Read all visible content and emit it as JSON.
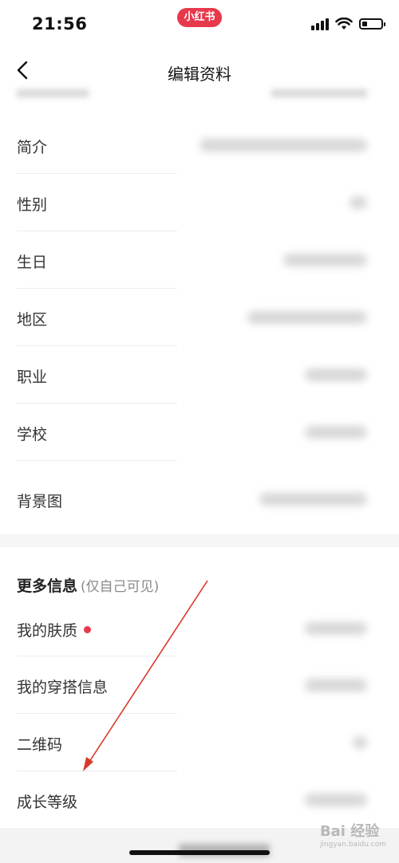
{
  "status_bar": {
    "time": "21:56",
    "app_badge": "小红书"
  },
  "nav": {
    "title": "编辑资料"
  },
  "rows": [
    {
      "label": "简介"
    },
    {
      "label": "性别"
    },
    {
      "label": "生日"
    },
    {
      "label": "地区"
    },
    {
      "label": "职业"
    },
    {
      "label": "学校"
    },
    {
      "label": "背景图"
    }
  ],
  "more_info": {
    "title": "更多信息",
    "note": "(仅自己可见)",
    "items": [
      {
        "label": "我的肤质",
        "has_dot": true
      },
      {
        "label": "我的穿搭信息"
      },
      {
        "label": "二维码"
      },
      {
        "label": "成长等级"
      }
    ]
  },
  "watermark": {
    "text": "Bai 经验",
    "sub": "jingyan.baidu.com"
  },
  "colors": {
    "accent": "#e8384c",
    "annotation_arrow": "#d83a2a"
  },
  "icons": [
    "back-chevron-icon",
    "signal-icon",
    "wifi-icon",
    "battery-icon"
  ]
}
